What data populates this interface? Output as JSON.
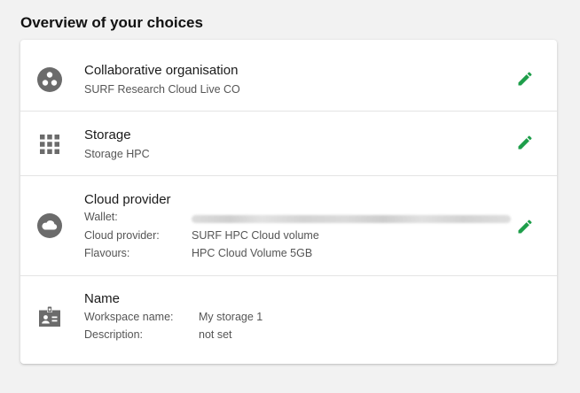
{
  "page": {
    "title": "Overview of your choices"
  },
  "colors": {
    "accent_edit": "#1e9e4a",
    "icon_grey": "#6b6b6b"
  },
  "rows": [
    {
      "icon": "group-icon",
      "title": "Collaborative organisation",
      "subtitle": "SURF Research Cloud Live CO",
      "edit_icon": "pencil-icon"
    },
    {
      "icon": "grid-apps-icon",
      "title": "Storage",
      "subtitle": "Storage HPC",
      "edit_icon": "pencil-icon"
    },
    {
      "icon": "cloud-icon",
      "title": "Cloud provider",
      "fields": [
        {
          "label": "Wallet:",
          "value": ""
        },
        {
          "label": "Cloud provider:",
          "value": "SURF HPC Cloud volume"
        },
        {
          "label": "Flavours:",
          "value": "HPC Cloud Volume 5GB"
        }
      ],
      "edit_icon": "pencil-icon"
    },
    {
      "icon": "badge-icon",
      "title": "Name",
      "fields": [
        {
          "label": "Workspace name:",
          "value": "My storage 1"
        },
        {
          "label": "Description:",
          "value": "not set"
        }
      ]
    }
  ]
}
